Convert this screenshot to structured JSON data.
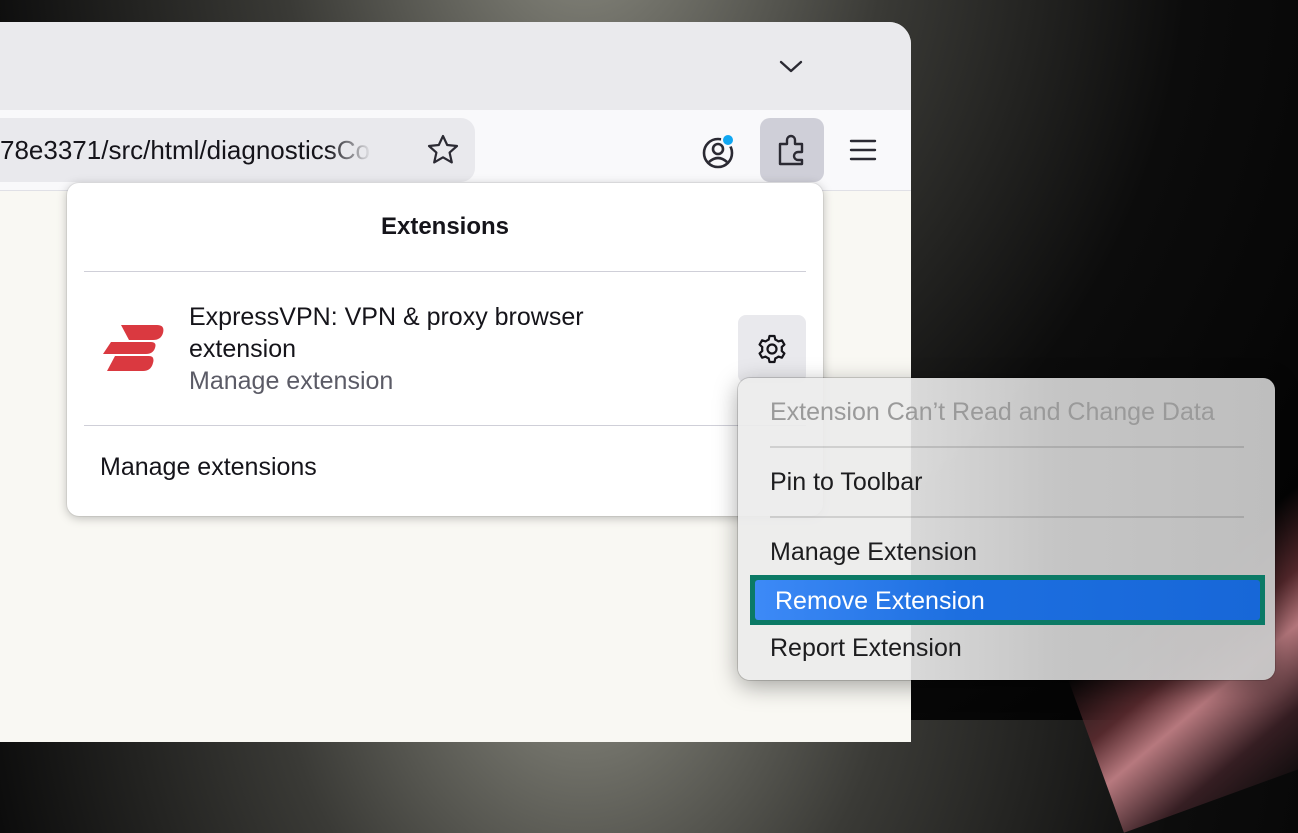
{
  "browser": {
    "url_text": "78e3371/src/html/diagnosticsCo",
    "icons": {
      "tab_list": "chevron-down-icon",
      "bookmark": "star-icon",
      "account": "account-icon",
      "extensions": "puzzle-piece-icon",
      "menu": "hamburger-menu-icon"
    },
    "colors": {
      "account_badge": "#10a7f2"
    }
  },
  "extensions_panel": {
    "title": "Extensions",
    "extension": {
      "name": "ExpressVPN: VPN & proxy browser extension",
      "subtitle": "Manage extension",
      "icon": "expressvpn-logo",
      "brand_color": "#da3940"
    },
    "manage_all_label": "Manage extensions"
  },
  "context_menu": {
    "items": [
      {
        "label": "Extension Can’t Read and Change Data",
        "enabled": false
      },
      {
        "label": "Pin to Toolbar",
        "enabled": true
      },
      {
        "label": "Manage Extension",
        "enabled": true
      },
      {
        "label": "Remove Extension",
        "enabled": true,
        "highlighted": true
      },
      {
        "label": "Report Extension",
        "enabled": true
      }
    ],
    "highlight_color": "#1d6fe0",
    "annotation_color": "#0b7a66"
  }
}
